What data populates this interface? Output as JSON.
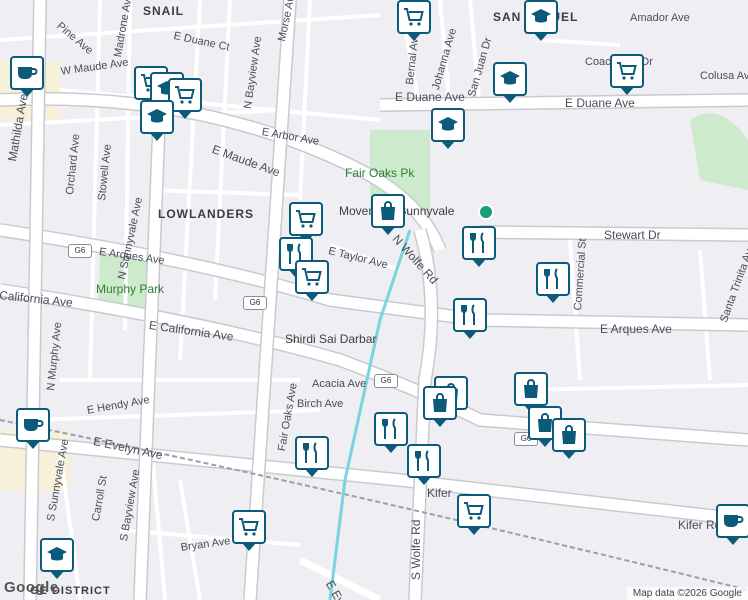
{
  "map": {
    "attribution": "Map data ©2026 Google",
    "logo": "Google",
    "neighborhoods": [
      "SNAIL",
      "LOWLANDERS",
      "SAN MIGUEL"
    ],
    "parks": [
      "Fair Oaks Pk",
      "Murphy Park"
    ],
    "poi_labels": [
      "Movement Sunnyvale",
      "Shirdi Sai Darbar",
      "GE DISTRICT"
    ],
    "streets": [
      "W Maude Ave",
      "E Maude Ave",
      "E Duane Ave",
      "E Arbor Ave",
      "E Arques Ave",
      "E California Ave",
      "California Ave",
      "E Taylor Ave",
      "N Wolfe Rd",
      "S Wolfe Rd",
      "Stewart Dr",
      "Kifer Rd",
      "Acacia Ave",
      "Birch Ave",
      "E Hendy Ave",
      "E Evelyn Ave",
      "Bryan Ave",
      "Fair Oaks Ave",
      "Morse Ave",
      "N Sunnyvale Ave",
      "S Sunnyvale Ave",
      "N Murphy Ave",
      "S Murphy Ave",
      "Stowell Ave",
      "Orchard Ave",
      "Carroll St",
      "S Bayview Ave",
      "N Bayview Ave",
      "Madrone Ave",
      "Pine Ave",
      "Mathilda Ave",
      "Bernal Ave",
      "Johanna Ave",
      "San Juan Dr",
      "Amador Ave",
      "Coachman Dr",
      "Colusa Ave",
      "Commercial St",
      "Santa Trinita Ave",
      "E Duane Ct",
      "Sunnyvale Ave",
      "E Ev",
      "Kifer"
    ],
    "route_shields": [
      "G6",
      "G6",
      "G6",
      "G6"
    ],
    "markers": [
      {
        "type": "shopping-cart"
      },
      {
        "type": "school"
      },
      {
        "type": "coffee"
      },
      {
        "type": "shopping-cart"
      },
      {
        "type": "shopping-cart"
      },
      {
        "type": "school"
      },
      {
        "type": "school"
      },
      {
        "type": "school"
      },
      {
        "type": "shopping-cart"
      },
      {
        "type": "shopping-bag"
      },
      {
        "type": "shopping-cart"
      },
      {
        "type": "restaurant"
      },
      {
        "type": "shopping-cart"
      },
      {
        "type": "restaurant"
      },
      {
        "type": "restaurant"
      },
      {
        "type": "restaurant"
      },
      {
        "type": "shopping-bag"
      },
      {
        "type": "shopping-bag"
      },
      {
        "type": "shopping-bag"
      },
      {
        "type": "shopping-bag"
      },
      {
        "type": "restaurant"
      },
      {
        "type": "restaurant"
      },
      {
        "type": "restaurant"
      },
      {
        "type": "coffee"
      },
      {
        "type": "shopping-cart"
      },
      {
        "type": "shopping-cart"
      },
      {
        "type": "school"
      },
      {
        "type": "coffee"
      }
    ]
  }
}
